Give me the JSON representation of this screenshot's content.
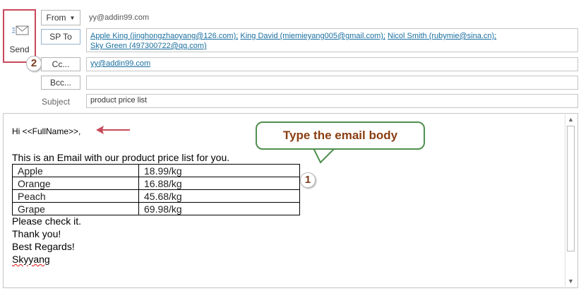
{
  "send": {
    "label": "Send",
    "badge": "2"
  },
  "header": {
    "from_button": "From",
    "from_value": "yy@addin99.com",
    "to_button": "SP To",
    "to_recipients_line1": [
      "Apple King (jinghongzhaoyang@126.com);",
      "King David (miemieyang005@gmail.com);",
      "Nicol Smith (rubymie@sina.cn);"
    ],
    "to_recipients_line2": "Sky Green (497300722@qq.com)",
    "cc_button": "Cc...",
    "cc_value": "yy@addin99.com",
    "bcc_button": "Bcc...",
    "bcc_value": "",
    "subject_label": "Subject",
    "subject_value": "product price list"
  },
  "body": {
    "greeting": "Hi <<FullName>>,",
    "intro": "This is an Email with our product price list for you.",
    "table": [
      [
        "Apple",
        "18.99/kg"
      ],
      [
        "Orange",
        "16.88/kg"
      ],
      [
        "Peach",
        "45.68/kg"
      ],
      [
        "Grape",
        "69.98/kg"
      ]
    ],
    "line_check": "Please check it.",
    "line_thanks": "Thank you!",
    "line_regards": "Best Regards!",
    "signature": "Skyyang"
  },
  "annotation": {
    "callout_text": "Type the email body",
    "badge": "1",
    "arrow_color": "#c94a5a",
    "callout_border_color": "#4f8f4f",
    "callout_text_color": "#8a3e12"
  },
  "colors": {
    "send_highlight": "#c9485b",
    "link": "#1a6fa0"
  }
}
